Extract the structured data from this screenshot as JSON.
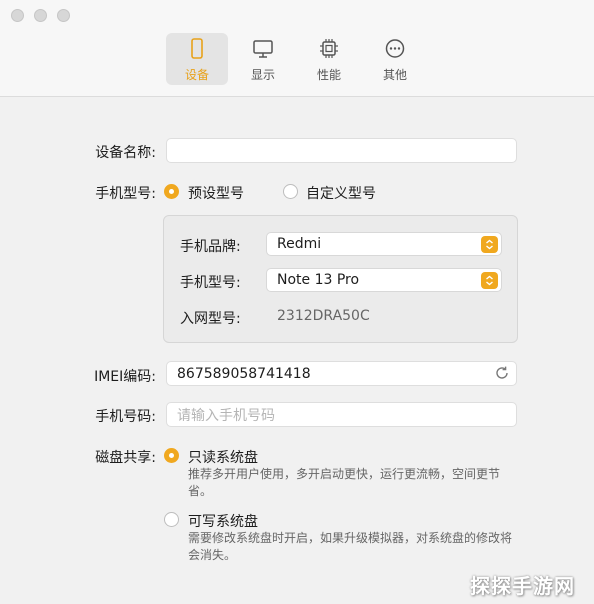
{
  "tabs": [
    {
      "label": "设备",
      "icon": "phone-icon",
      "active": true
    },
    {
      "label": "显示",
      "icon": "monitor-icon",
      "active": false
    },
    {
      "label": "性能",
      "icon": "chip-icon",
      "active": false
    },
    {
      "label": "其他",
      "icon": "ellipsis-icon",
      "active": false
    }
  ],
  "form": {
    "device_name_label": "设备名称:",
    "device_name_value": "",
    "model_label": "手机型号:",
    "model_option_preset": "预设型号",
    "model_option_custom": "自定义型号",
    "brand_label": "手机品牌:",
    "brand_value": "Redmi",
    "phone_model_label": "手机型号:",
    "phone_model_value": "Note 13 Pro",
    "network_model_label": "入网型号:",
    "network_model_value": "2312DRA50C",
    "imei_label": "IMEI编码:",
    "imei_value": "867589058741418",
    "phone_number_label": "手机号码:",
    "phone_number_placeholder": "请输入手机号码",
    "disk_label": "磁盘共享:",
    "disk_readonly_label": "只读系统盘",
    "disk_readonly_desc": "推荐多开用户使用，多开启动更快，运行更流畅，空间更节省。",
    "disk_writable_label": "可写系统盘",
    "disk_writable_desc": "需要修改系统盘时开启，如果升级模拟器，对系统盘的修改将会消失。"
  },
  "watermark": "探探手游网",
  "colors": {
    "accent": "#f0a81f",
    "background": "#f1f1f1"
  }
}
